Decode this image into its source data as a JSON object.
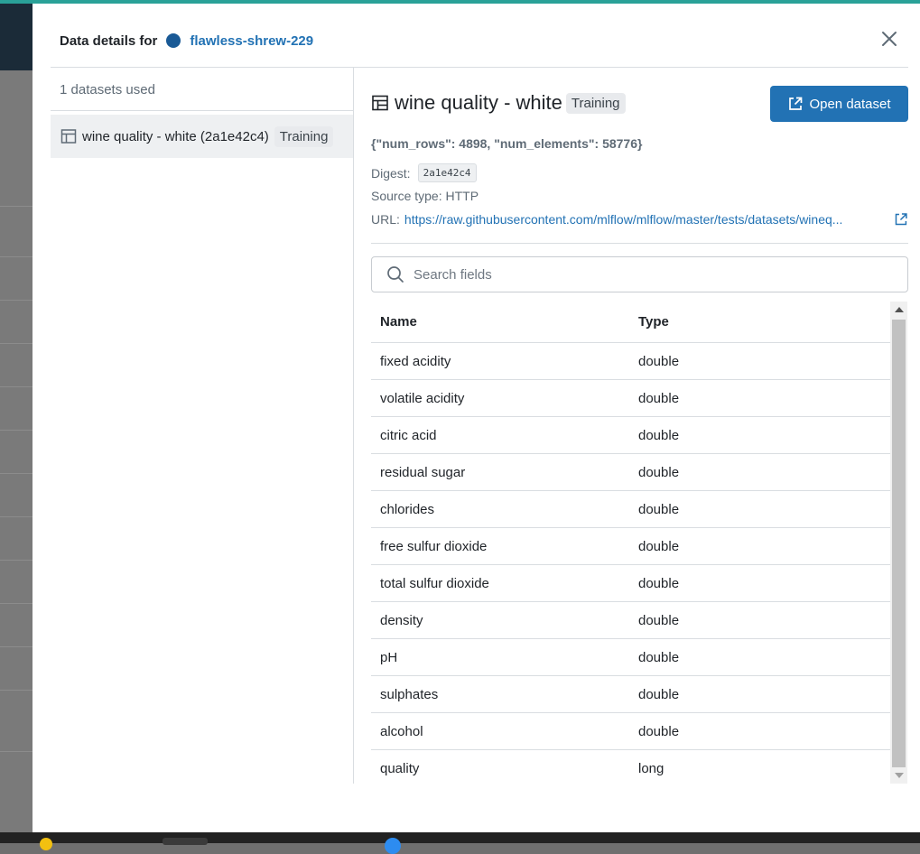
{
  "modal": {
    "title": "Data details for",
    "run_name": "flawless-shrew-229",
    "run_color": "#1a5a96",
    "close_icon": "close-icon"
  },
  "sidebar": {
    "datasets_count_label": "1 datasets used",
    "items": [
      {
        "label": "wine quality - white (2a1e42c4)",
        "tag": "Training",
        "icon": "table-icon"
      }
    ]
  },
  "dataset": {
    "name": "wine quality - white",
    "tag": "Training",
    "open_button_label": "Open dataset",
    "profile": "{\"num_rows\": 4898, \"num_elements\": 58776}",
    "digest_label": "Digest:",
    "digest_value": "2a1e42c4",
    "source_type": "Source type: HTTP",
    "url_label": "URL:",
    "url": "https://raw.githubusercontent.com/mlflow/mlflow/master/tests/datasets/wineq..."
  },
  "search": {
    "placeholder": "Search fields",
    "value": ""
  },
  "schema_table": {
    "headers": [
      "Name",
      "Type"
    ],
    "rows": [
      [
        "fixed acidity",
        "double"
      ],
      [
        "volatile acidity",
        "double"
      ],
      [
        "citric acid",
        "double"
      ],
      [
        "residual sugar",
        "double"
      ],
      [
        "chlorides",
        "double"
      ],
      [
        "free sulfur dioxide",
        "double"
      ],
      [
        "total sulfur dioxide",
        "double"
      ],
      [
        "density",
        "double"
      ],
      [
        "pH",
        "double"
      ],
      [
        "sulphates",
        "double"
      ],
      [
        "alcohol",
        "double"
      ],
      [
        "quality",
        "long"
      ]
    ]
  },
  "colors": {
    "accent": "#2272b4",
    "text": "#1f2328",
    "muted": "#5f6b76"
  }
}
